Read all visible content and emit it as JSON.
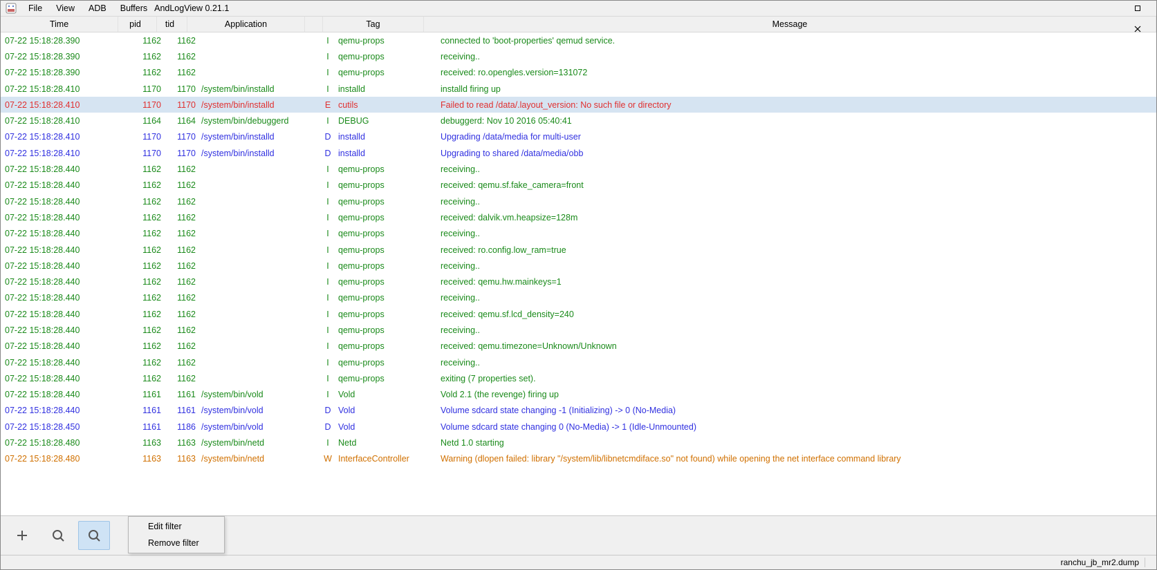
{
  "title": "AndLogView 0.21.1",
  "menu": {
    "file": "File",
    "view": "View",
    "adb": "ADB",
    "buffers": "Buffers"
  },
  "columns": {
    "time": "Time",
    "pid": "pid",
    "tid": "tid",
    "app": "Application",
    "level": "",
    "tag": "Tag",
    "msg": "Message"
  },
  "ctx": {
    "edit": "Edit filter",
    "remove": "Remove filter"
  },
  "status": {
    "filename": "ranchu_jb_mr2.dump"
  },
  "selected_index": 4,
  "rows": [
    {
      "time": "07-22 15:18:28.390",
      "pid": "1162",
      "tid": "1162",
      "app": "",
      "lvl": "I",
      "tag": "qemu-props",
      "msg": "connected to 'boot-properties' qemud service."
    },
    {
      "time": "07-22 15:18:28.390",
      "pid": "1162",
      "tid": "1162",
      "app": "",
      "lvl": "I",
      "tag": "qemu-props",
      "msg": "receiving.."
    },
    {
      "time": "07-22 15:18:28.390",
      "pid": "1162",
      "tid": "1162",
      "app": "",
      "lvl": "I",
      "tag": "qemu-props",
      "msg": "received: ro.opengles.version=131072"
    },
    {
      "time": "07-22 15:18:28.410",
      "pid": "1170",
      "tid": "1170",
      "app": "/system/bin/installd",
      "lvl": "I",
      "tag": "installd",
      "msg": "installd firing up"
    },
    {
      "time": "07-22 15:18:28.410",
      "pid": "1170",
      "tid": "1170",
      "app": "/system/bin/installd",
      "lvl": "E",
      "tag": "cutils",
      "msg": "Failed to read /data/.layout_version: No such file or directory"
    },
    {
      "time": "07-22 15:18:28.410",
      "pid": "1164",
      "tid": "1164",
      "app": "/system/bin/debuggerd",
      "lvl": "I",
      "tag": "DEBUG",
      "msg": "debuggerd: Nov 10 2016 05:40:41"
    },
    {
      "time": "07-22 15:18:28.410",
      "pid": "1170",
      "tid": "1170",
      "app": "/system/bin/installd",
      "lvl": "D",
      "tag": "installd",
      "msg": "Upgrading /data/media for multi-user"
    },
    {
      "time": "07-22 15:18:28.410",
      "pid": "1170",
      "tid": "1170",
      "app": "/system/bin/installd",
      "lvl": "D",
      "tag": "installd",
      "msg": "Upgrading to shared /data/media/obb"
    },
    {
      "time": "07-22 15:18:28.440",
      "pid": "1162",
      "tid": "1162",
      "app": "",
      "lvl": "I",
      "tag": "qemu-props",
      "msg": "receiving.."
    },
    {
      "time": "07-22 15:18:28.440",
      "pid": "1162",
      "tid": "1162",
      "app": "",
      "lvl": "I",
      "tag": "qemu-props",
      "msg": "received: qemu.sf.fake_camera=front"
    },
    {
      "time": "07-22 15:18:28.440",
      "pid": "1162",
      "tid": "1162",
      "app": "",
      "lvl": "I",
      "tag": "qemu-props",
      "msg": "receiving.."
    },
    {
      "time": "07-22 15:18:28.440",
      "pid": "1162",
      "tid": "1162",
      "app": "",
      "lvl": "I",
      "tag": "qemu-props",
      "msg": "received: dalvik.vm.heapsize=128m"
    },
    {
      "time": "07-22 15:18:28.440",
      "pid": "1162",
      "tid": "1162",
      "app": "",
      "lvl": "I",
      "tag": "qemu-props",
      "msg": "receiving.."
    },
    {
      "time": "07-22 15:18:28.440",
      "pid": "1162",
      "tid": "1162",
      "app": "",
      "lvl": "I",
      "tag": "qemu-props",
      "msg": "received: ro.config.low_ram=true"
    },
    {
      "time": "07-22 15:18:28.440",
      "pid": "1162",
      "tid": "1162",
      "app": "",
      "lvl": "I",
      "tag": "qemu-props",
      "msg": "receiving.."
    },
    {
      "time": "07-22 15:18:28.440",
      "pid": "1162",
      "tid": "1162",
      "app": "",
      "lvl": "I",
      "tag": "qemu-props",
      "msg": "received: qemu.hw.mainkeys=1"
    },
    {
      "time": "07-22 15:18:28.440",
      "pid": "1162",
      "tid": "1162",
      "app": "",
      "lvl": "I",
      "tag": "qemu-props",
      "msg": "receiving.."
    },
    {
      "time": "07-22 15:18:28.440",
      "pid": "1162",
      "tid": "1162",
      "app": "",
      "lvl": "I",
      "tag": "qemu-props",
      "msg": "received: qemu.sf.lcd_density=240"
    },
    {
      "time": "07-22 15:18:28.440",
      "pid": "1162",
      "tid": "1162",
      "app": "",
      "lvl": "I",
      "tag": "qemu-props",
      "msg": "receiving.."
    },
    {
      "time": "07-22 15:18:28.440",
      "pid": "1162",
      "tid": "1162",
      "app": "",
      "lvl": "I",
      "tag": "qemu-props",
      "msg": "received: qemu.timezone=Unknown/Unknown"
    },
    {
      "time": "07-22 15:18:28.440",
      "pid": "1162",
      "tid": "1162",
      "app": "",
      "lvl": "I",
      "tag": "qemu-props",
      "msg": "receiving.."
    },
    {
      "time": "07-22 15:18:28.440",
      "pid": "1162",
      "tid": "1162",
      "app": "",
      "lvl": "I",
      "tag": "qemu-props",
      "msg": "exiting (7 properties set)."
    },
    {
      "time": "07-22 15:18:28.440",
      "pid": "1161",
      "tid": "1161",
      "app": "/system/bin/vold",
      "lvl": "I",
      "tag": "Vold",
      "msg": "Vold 2.1 (the revenge) firing up"
    },
    {
      "time": "07-22 15:18:28.440",
      "pid": "1161",
      "tid": "1161",
      "app": "/system/bin/vold",
      "lvl": "D",
      "tag": "Vold",
      "msg": "Volume sdcard state changing -1 (Initializing) -> 0 (No-Media)"
    },
    {
      "time": "07-22 15:18:28.450",
      "pid": "1161",
      "tid": "1186",
      "app": "/system/bin/vold",
      "lvl": "D",
      "tag": "Vold",
      "msg": "Volume sdcard state changing 0 (No-Media) -> 1 (Idle-Unmounted)"
    },
    {
      "time": "07-22 15:18:28.480",
      "pid": "1163",
      "tid": "1163",
      "app": "/system/bin/netd",
      "lvl": "I",
      "tag": "Netd",
      "msg": "Netd 1.0 starting"
    },
    {
      "time": "07-22 15:18:28.480",
      "pid": "1163",
      "tid": "1163",
      "app": "/system/bin/netd",
      "lvl": "W",
      "tag": "InterfaceController",
      "msg": "Warning (dlopen failed: library \"/system/lib/libnetcmdiface.so\" not found) while opening the net interface command library"
    }
  ]
}
